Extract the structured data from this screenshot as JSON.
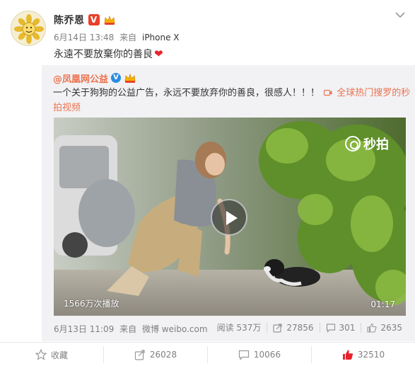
{
  "post": {
    "username": "陈乔恩",
    "vip_badge": "V",
    "date": "6月14日 13:48",
    "source_prefix": "来自",
    "source": "iPhone X",
    "text": "永遠不要放棄你的善良",
    "emoji": "❤"
  },
  "repost": {
    "username": "@凤凰网公益",
    "text": "一个关于狗狗的公益广告，永远不要放弃你的善良，很感人！！！",
    "video_link": "全球热门搜罗的秒拍视频",
    "video": {
      "watermark": "秒拍",
      "plays": "1566万次播放",
      "duration": "01:17"
    },
    "date": "6月13日 11:09",
    "source_prefix": "来自",
    "source": "微博 weibo.com",
    "reads": "阅读 537万",
    "reposts": "27856",
    "comments": "301",
    "likes": "2635"
  },
  "actions": {
    "favorite": "收藏",
    "repost": "26028",
    "comment": "10066",
    "like": "32510"
  },
  "colors": {
    "accent_orange": "#eb7350",
    "like_red": "#e8222d",
    "repost_bg": "#f2f2f5"
  }
}
